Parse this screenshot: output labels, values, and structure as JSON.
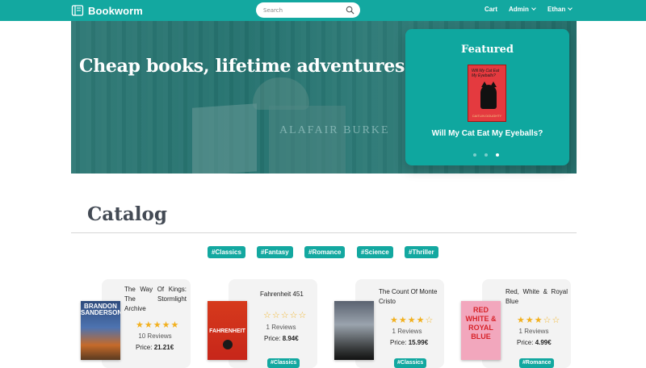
{
  "navbar": {
    "brand": "Bookworm",
    "search_placeholder": "Search",
    "cart": "Cart",
    "admin": "Admin",
    "user": "Ethan"
  },
  "hero": {
    "headline": "Cheap books, lifetime adventures!",
    "background_book_text": "ALAFAIR BURKE"
  },
  "featured": {
    "heading": "Featured",
    "book_title": "Will My Cat Eat My Eyeballs?",
    "cover_text": "Will My Cat Eat My Eyeballs?",
    "cover_author": "CAITLIN DOUGHTY",
    "slides": 3,
    "active_slide": 3
  },
  "catalog": {
    "title": "Catalog",
    "tags": [
      "#Classics",
      "#Fantasy",
      "#Romance",
      "#Science",
      "#Thriller"
    ]
  },
  "books": [
    {
      "title": "The Way Of Kings: The Stormlight Archive",
      "rating": 5,
      "reviews": "10 Reviews",
      "price_label": "Price:",
      "price": "21.21€",
      "cover_text": "BRANDON SANDERSON",
      "tag": ""
    },
    {
      "title": "Fahrenheit 451",
      "rating": 0,
      "reviews": "1 Reviews",
      "price_label": "Price:",
      "price": "8.94€",
      "cover_text": "FAHRENHEIT",
      "tag": "#Classics"
    },
    {
      "title": "The Count Of Monte Cristo",
      "rating": 4,
      "reviews": "1 Reviews",
      "price_label": "Price:",
      "price": "15.99€",
      "cover_text": "",
      "tag": "#Classics"
    },
    {
      "title": "Red, White & Royal Blue",
      "rating": 3,
      "reviews": "1 Reviews",
      "price_label": "Price:",
      "price": "4.99€",
      "cover_text": "RED WHITE & ROYAL BLUE",
      "tag": "#Romance"
    }
  ],
  "colors": {
    "accent": "#13a8a0",
    "star": "#f2b01e",
    "heading": "#434a54"
  }
}
